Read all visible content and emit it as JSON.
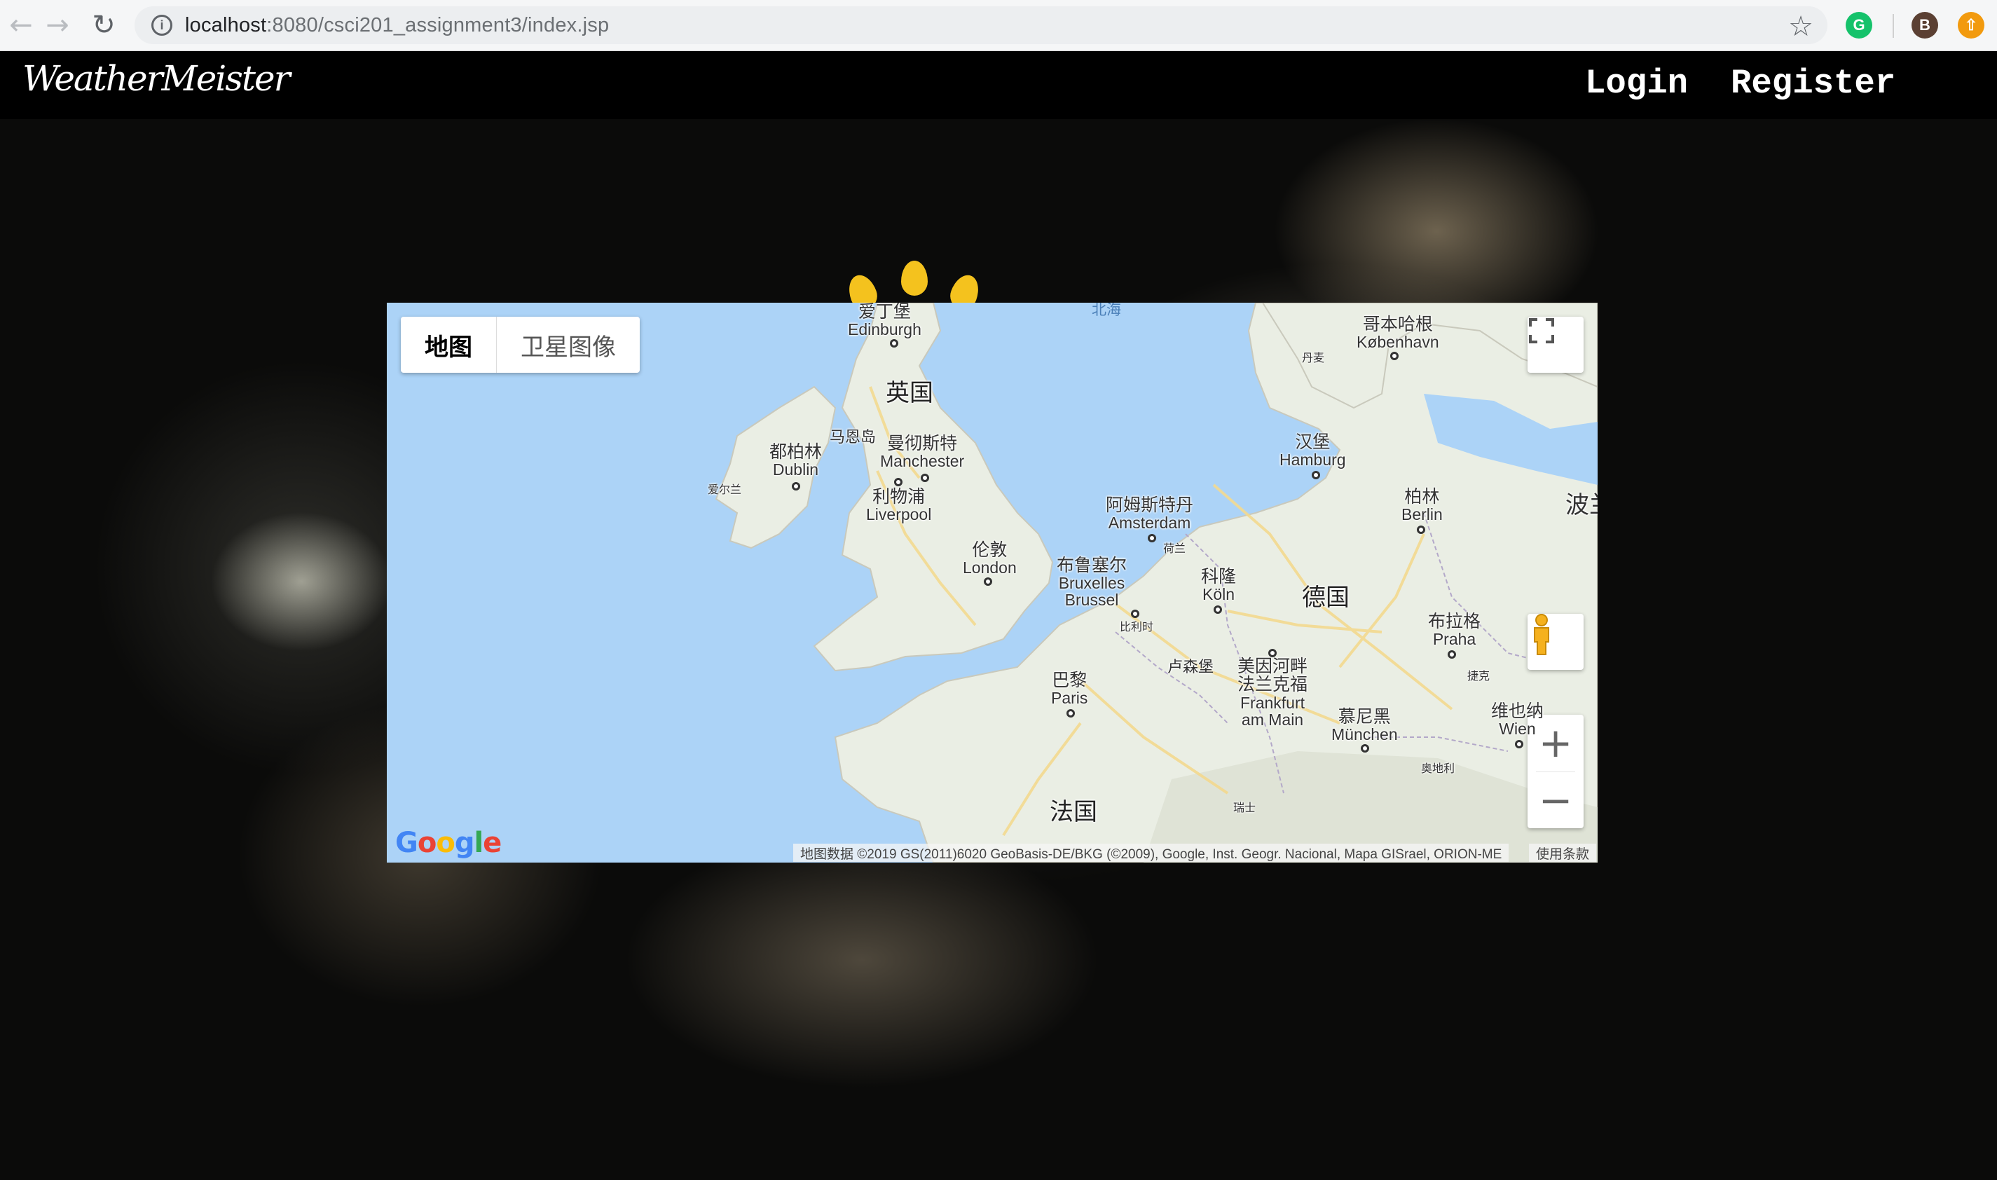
{
  "browser": {
    "url_host": "localhost",
    "url_path": ":8080/csci201_assignment3/index.jsp",
    "back_icon": "arrow-left-icon",
    "forward_icon": "arrow-right-icon",
    "reload_icon": "reload-icon",
    "star_icon": "star-icon",
    "extensions": [
      {
        "name": "grammarly-extension",
        "label": "G"
      },
      {
        "name": "profile-avatar",
        "label": "B"
      },
      {
        "name": "orange-extension",
        "label": "⇧"
      }
    ]
  },
  "header": {
    "logo": "WeatherMeister",
    "nav": {
      "login": "Login",
      "register": "Register"
    }
  },
  "map": {
    "type_buttons": {
      "map": "地图",
      "satellite": "卫星图像"
    },
    "selected_type": "地图",
    "zoom_in": "+",
    "zoom_out": "−",
    "logo": "Google",
    "attribution": "地图数据 ©2019 GS(2011)6020 GeoBasis-DE/BKG (©2009), Google, Inst. Geogr. Nacional, Mapa GISrael, ORION-ME",
    "terms": "使用条款",
    "labels": {
      "edinburgh": {
        "zh": "爱丁堡",
        "en": "Edinburgh"
      },
      "uk": "英国",
      "isle_of_man": "马恩岛",
      "dublin": {
        "zh": "都柏林",
        "en": "Dublin"
      },
      "ireland": "爱尔兰",
      "manchester": {
        "zh": "曼彻斯特",
        "en": "Manchester"
      },
      "liverpool": {
        "zh": "利物浦",
        "en": "Liverpool"
      },
      "london": {
        "zh": "伦敦",
        "en": "London"
      },
      "north_sea": "北海",
      "copenhagen": {
        "zh": "哥本哈根",
        "en": "København"
      },
      "denmark": "丹麦",
      "hamburg": {
        "zh": "汉堡",
        "en": "Hamburg"
      },
      "amsterdam": {
        "zh": "阿姆斯特丹",
        "en": "Amsterdam"
      },
      "netherlands": "荷兰",
      "berlin": {
        "zh": "柏林",
        "en": "Berlin"
      },
      "poland": "波兰",
      "brussels": {
        "zh": "布鲁塞尔",
        "en1": "Bruxelles",
        "en2": "Brussel"
      },
      "cologne": {
        "zh": "科隆",
        "en": "Köln"
      },
      "germany": "德国",
      "belgium": "比利时",
      "prague": {
        "zh": "布拉格",
        "en": "Praha"
      },
      "luxembourg": "卢森堡",
      "frankfurt": {
        "zh1": "美因河畔",
        "zh2": "法兰克福",
        "en1": "Frankfurt",
        "en2": "am Main"
      },
      "czech": "捷克",
      "paris": {
        "zh": "巴黎",
        "en": "Paris"
      },
      "munich": {
        "zh": "慕尼黑",
        "en": "München"
      },
      "vienna": {
        "zh": "维也纳",
        "en": "Wien"
      },
      "austria": "奥地利",
      "france": "法国",
      "switzerland": "瑞士"
    }
  }
}
